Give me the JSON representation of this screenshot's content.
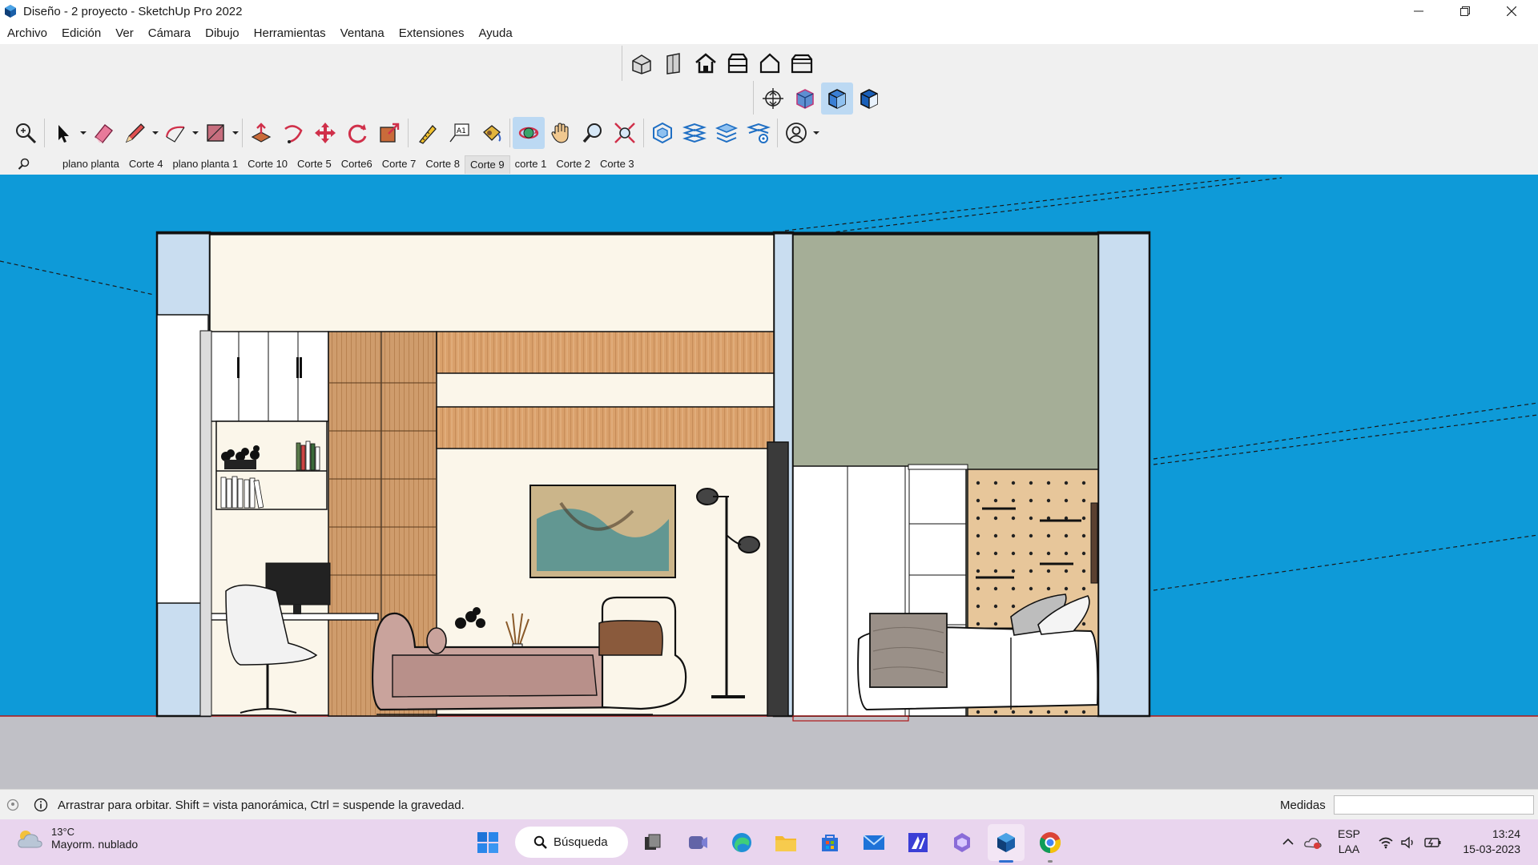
{
  "window": {
    "title": "Diseño - 2 proyecto - SketchUp Pro 2022",
    "controls": {
      "minimize": "minimize-icon",
      "restore": "restore-icon",
      "close": "close-icon"
    }
  },
  "menubar": {
    "items": [
      "Archivo",
      "Edición",
      "Ver",
      "Cámara",
      "Dibujo",
      "Herramientas",
      "Ventana",
      "Extensiones",
      "Ayuda"
    ]
  },
  "toolbars": {
    "views": [
      "iso-view-icon",
      "top-view-icon",
      "front-view-icon",
      "right-view-icon",
      "back-view-icon",
      "left-view-icon"
    ],
    "styles": [
      "xray-icon",
      "back-edges-icon",
      "wireframe-icon",
      "hidden-line-icon"
    ],
    "main": [
      "zoom-extents-icon",
      "select-icon",
      "eraser-icon",
      "pencil-line-icon",
      "arc-icon",
      "rectangle-icon",
      "push-pull-icon",
      "follow-me-icon",
      "move-icon",
      "rotate-icon",
      "scale-icon",
      "tape-measure-icon",
      "text-icon",
      "paint-bucket-icon",
      "orbit-icon",
      "pan-icon",
      "zoom-icon",
      "zoom-window-icon",
      "section-plane-icon",
      "section-cut-icon",
      "section-fill-icon",
      "section-settings-icon",
      "account-icon"
    ],
    "accent": "#2f8fd8"
  },
  "scenes": {
    "tabs": [
      "plano planta",
      "Corte 4",
      "plano planta 1",
      "Corte 10",
      "Corte 5",
      "Corte6",
      "Corte 7",
      "Corte 8",
      "Corte 9",
      "corte 1",
      "Corte 2",
      "Corte 3"
    ],
    "active_index": 8,
    "search_icon": "search-icon"
  },
  "viewport": {
    "background": "#0e9ad8",
    "ground": "#c0c0c6",
    "model": "section-elevation-living-room-and-bedroom"
  },
  "statusbar": {
    "message": "Arrastrar para orbitar. Shift = vista panorámica, Ctrl = suspende la gravedad.",
    "measures_label": "Medidas",
    "measures_value": ""
  },
  "taskbar": {
    "weather": {
      "temp": "13°C",
      "desc": "Mayorm. nublado"
    },
    "search_label": "Búsqueda",
    "apps": [
      "windows-start-icon",
      "task-view-icon",
      "teams-icon",
      "edge-icon",
      "file-explorer-icon",
      "store-icon",
      "mail-icon",
      "autodesk-icon",
      "copilot-icon",
      "sketchup-icon",
      "chrome-icon"
    ],
    "tray": {
      "lang1": "ESP",
      "lang2": "LAA",
      "time": "13:24",
      "date": "15-03-2023"
    }
  }
}
